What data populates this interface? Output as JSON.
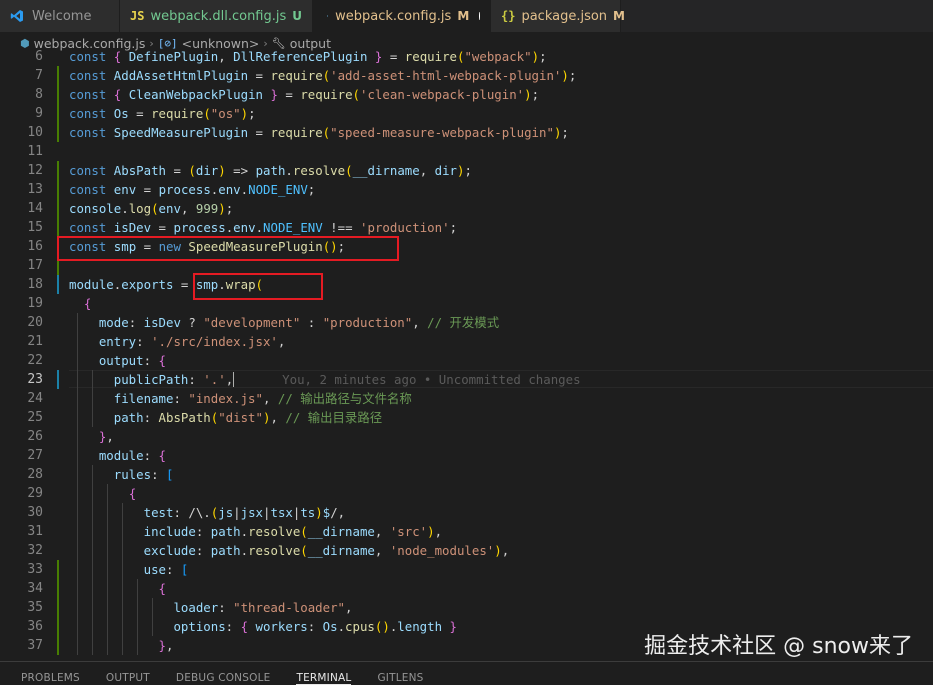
{
  "tabs": [
    {
      "label": "Welcome",
      "icon": "vscode-logo-icon",
      "badge": ""
    },
    {
      "label": "webpack.dll.config.js",
      "icon": "js-file-icon",
      "badge": "U"
    },
    {
      "label": "webpack.config.js",
      "icon": "webpack-file-icon",
      "badge": "M"
    },
    {
      "label": "package.json",
      "icon": "json-file-icon",
      "badge": "M"
    }
  ],
  "breadcrumb": {
    "file": "webpack.config.js",
    "symbol": "<unknown>",
    "property": "output"
  },
  "blame": "You, 2 minutes ago • Uncommitted changes",
  "code_lines": [
    {
      "n": "6",
      "text": "const { DefinePlugin, DllReferencePlugin } = require(\"webpack\");"
    },
    {
      "n": "7",
      "text": "const AddAssetHtmlPlugin = require('add-asset-html-webpack-plugin');"
    },
    {
      "n": "8",
      "text": "const { CleanWebpackPlugin } = require('clean-webpack-plugin');"
    },
    {
      "n": "9",
      "text": "const Os = require(\"os\");"
    },
    {
      "n": "10",
      "text": "const SpeedMeasurePlugin = require(\"speed-measure-webpack-plugin\");"
    },
    {
      "n": "11",
      "text": ""
    },
    {
      "n": "12",
      "text": "const AbsPath = (dir) => path.resolve(__dirname, dir);"
    },
    {
      "n": "13",
      "text": "const env = process.env.NODE_ENV;"
    },
    {
      "n": "14",
      "text": "console.log(env, 999);"
    },
    {
      "n": "15",
      "text": "const isDev = process.env.NODE_ENV !== 'production';"
    },
    {
      "n": "16",
      "text": "const smp = new SpeedMeasurePlugin();"
    },
    {
      "n": "17",
      "text": ""
    },
    {
      "n": "18",
      "text": "module.exports = smp.wrap("
    },
    {
      "n": "19",
      "text": "  {"
    },
    {
      "n": "20",
      "text": "    mode: isDev ? \"development\" : \"production\", // 开发模式"
    },
    {
      "n": "21",
      "text": "    entry: './src/index.jsx',"
    },
    {
      "n": "22",
      "text": "    output: {"
    },
    {
      "n": "23",
      "text": "      publicPath: '.',"
    },
    {
      "n": "24",
      "text": "      filename: \"index.js\", // 输出路径与文件名称"
    },
    {
      "n": "25",
      "text": "      path: AbsPath(\"dist\"), // 输出目录路径"
    },
    {
      "n": "26",
      "text": "    },"
    },
    {
      "n": "27",
      "text": "    module: {"
    },
    {
      "n": "28",
      "text": "      rules: ["
    },
    {
      "n": "29",
      "text": "        {"
    },
    {
      "n": "30",
      "text": "          test: /\\.(js|jsx|tsx|ts)$/,"
    },
    {
      "n": "31",
      "text": "          include: path.resolve(__dirname, 'src'),"
    },
    {
      "n": "32",
      "text": "          exclude: path.resolve(__dirname, 'node_modules'),"
    },
    {
      "n": "33",
      "text": "          use: ["
    },
    {
      "n": "34",
      "text": "            {"
    },
    {
      "n": "35",
      "text": "              loader: \"thread-loader\","
    },
    {
      "n": "36",
      "text": "              options: { workers: Os.cpus().length }"
    },
    {
      "n": "37",
      "text": "            },"
    }
  ],
  "watermark": "掘金技术社区 @ snow来了",
  "panel_tabs": [
    "PROBLEMS",
    "OUTPUT",
    "DEBUG CONSOLE",
    "TERMINAL",
    "GITLENS"
  ],
  "active_panel_tab": "TERMINAL",
  "colors": {
    "editor_bg": "#1e1e1e",
    "highlight_box": "#e51b23",
    "git_added": "#487e02",
    "git_modified": "#1b81a8"
  }
}
